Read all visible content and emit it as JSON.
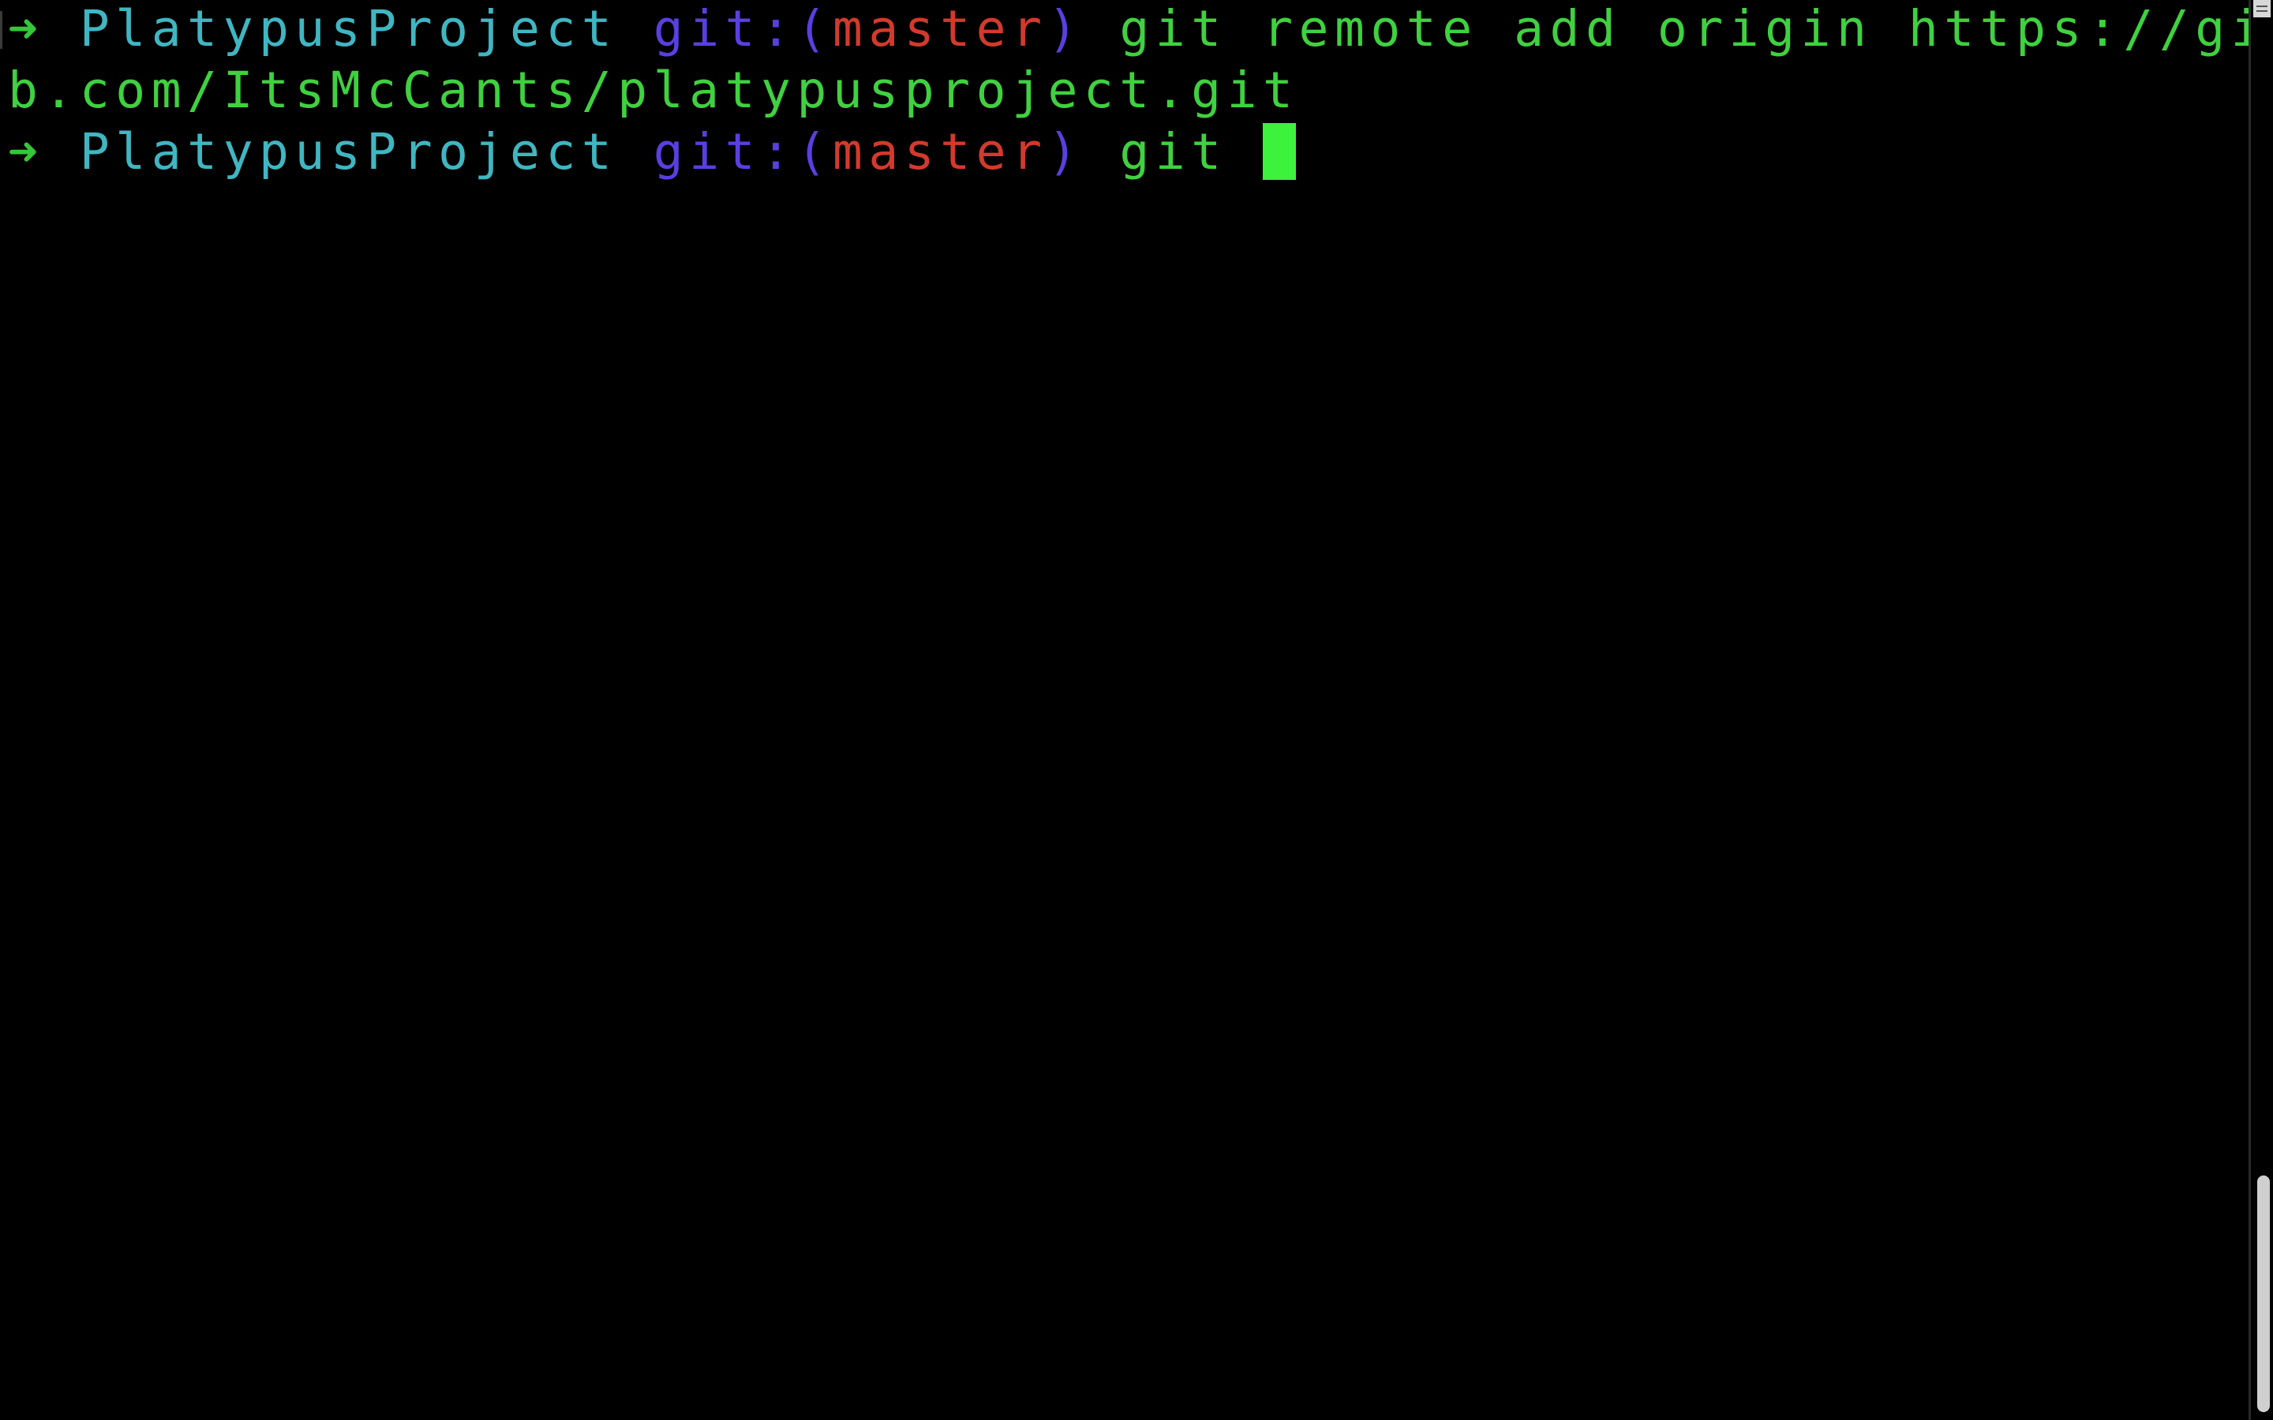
{
  "terminal": {
    "lines": [
      {
        "arrow": "➜",
        "dir": "PlatypusProject",
        "git_label": "git:(",
        "branch": "master",
        "git_close": ")",
        "command": "git remote add origin https://githu"
      },
      {
        "continuation": "b.com/ItsMcCants/platypusproject.git"
      },
      {
        "arrow": "➜",
        "dir": "PlatypusProject",
        "git_label": "git:(",
        "branch": "master",
        "git_close": ")",
        "command": "git "
      }
    ],
    "icons": {
      "prompt": "arrow-right-icon",
      "scroll_split": "split-pane-icon"
    },
    "colors": {
      "background": "#000000",
      "arrow": "#35c63a",
      "directory": "#3fb6c2",
      "git_label": "#5a3fe0",
      "branch": "#d23a2c",
      "command": "#3fd13f",
      "cursor": "#3df23d"
    }
  }
}
